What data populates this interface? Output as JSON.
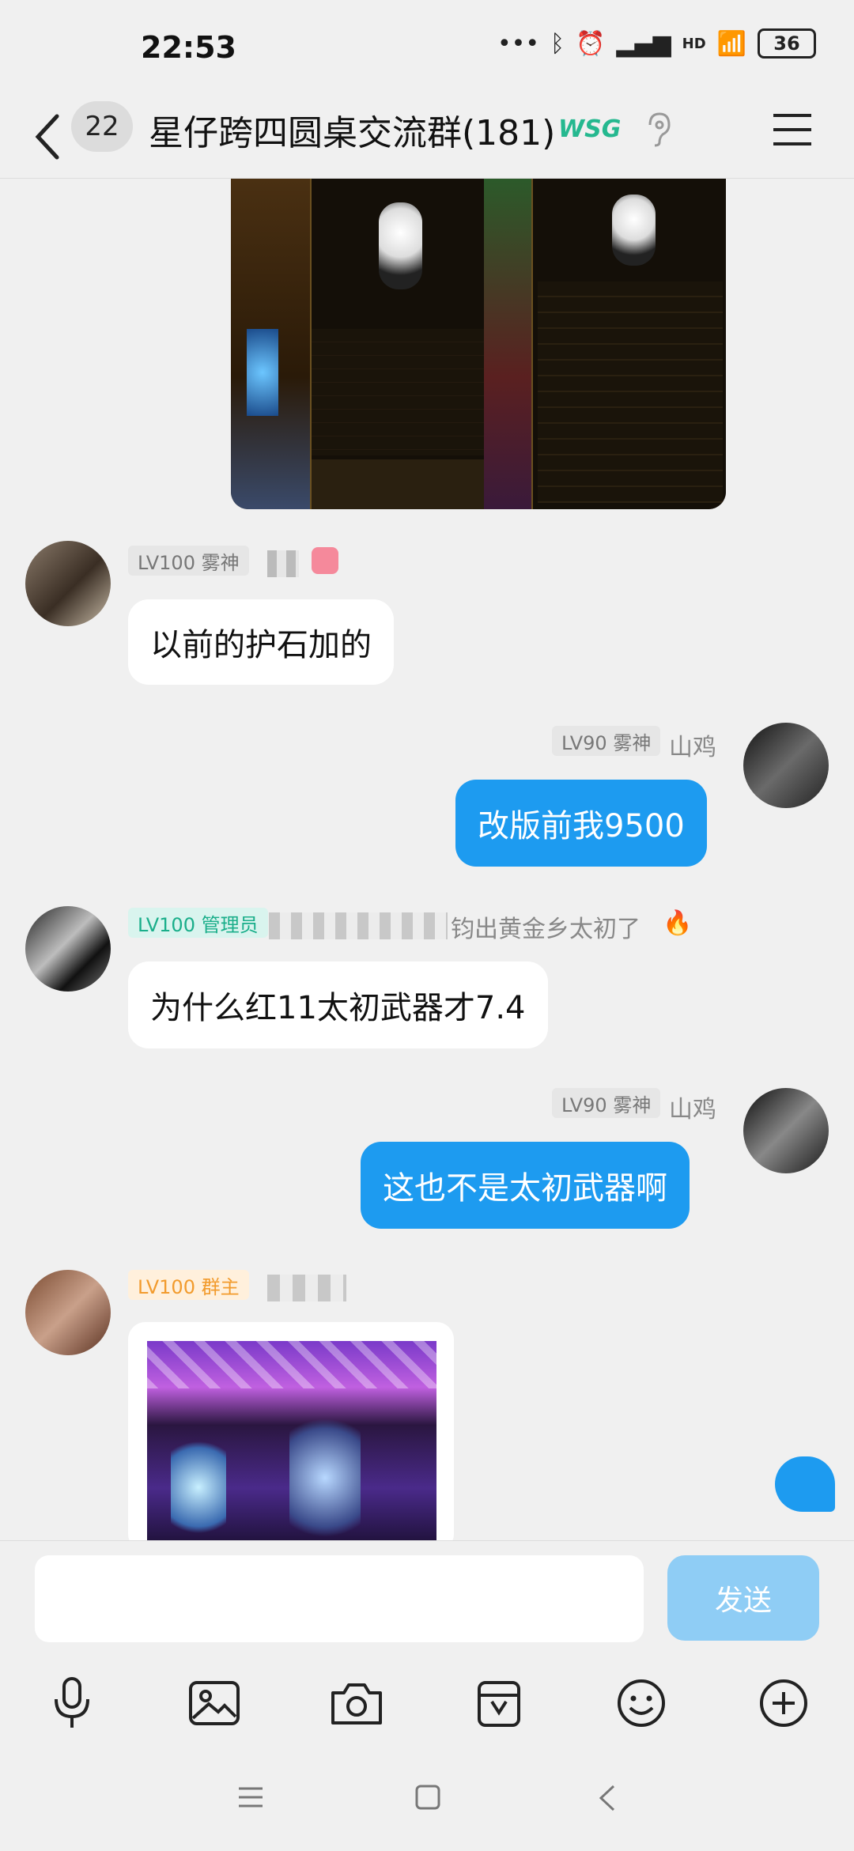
{
  "status": {
    "time": "22:53",
    "hd": "HD",
    "battery": "36"
  },
  "header": {
    "unread_count": "22",
    "title": "星仔跨四圆桌交流群(181)",
    "badge_text": "WSG"
  },
  "messages": [
    {
      "badge": "LV100 雾神",
      "text": "以前的护石加的"
    },
    {
      "badge": "LV90 雾神",
      "nick": "山鸡",
      "text": "改版前我9500"
    },
    {
      "badge": "LV100 管理员",
      "nick_partial": "钧出黄金乡太初了",
      "text": "为什么红11太初武器才7.4"
    },
    {
      "badge": "LV90 雾神",
      "nick": "山鸡",
      "text": "这也不是太初武器啊"
    },
    {
      "badge": "LV100 群主"
    }
  ],
  "composer": {
    "placeholder": "",
    "send_label": "发送"
  },
  "colors": {
    "outgoing_bubble": "#1d9bf0",
    "send_button": "#8fcdf5",
    "admin_badge": "#1aae8a",
    "owner_badge": "#f29b2d"
  },
  "icons": [
    "mic-icon",
    "image-icon",
    "camera-icon",
    "sticker-icon",
    "emoji-icon",
    "plus-icon"
  ]
}
